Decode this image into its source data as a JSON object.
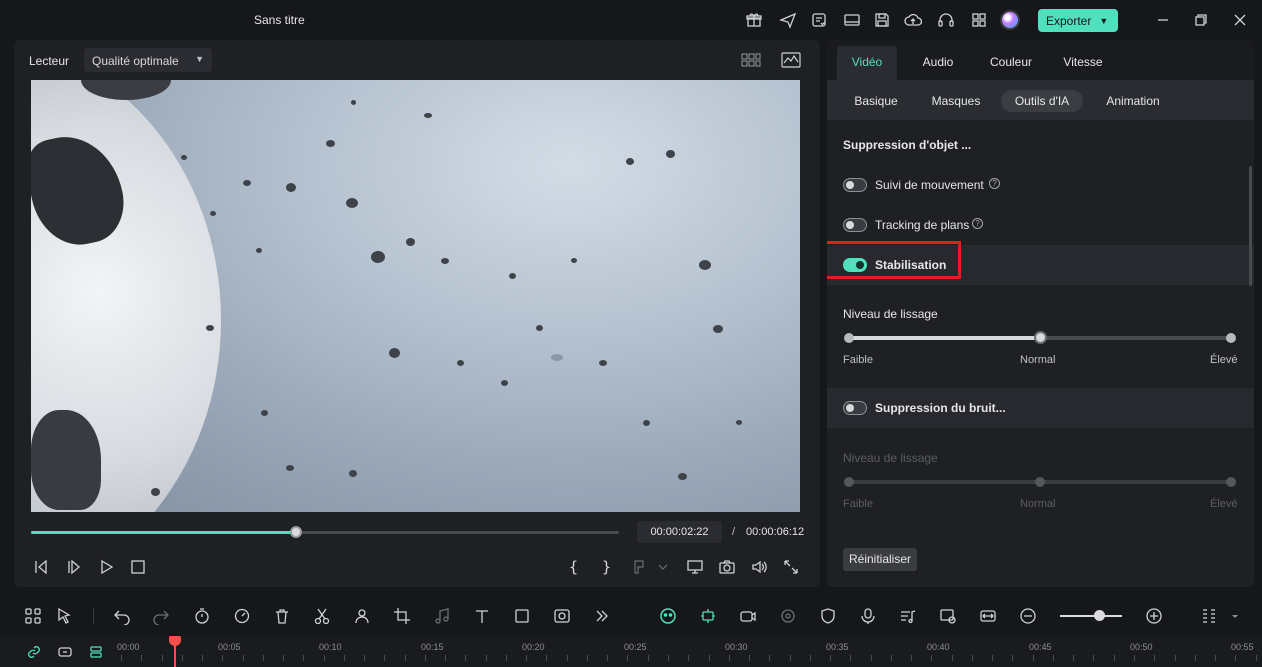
{
  "window": {
    "title": "Sans titre",
    "export_label": "Exporter",
    "accent": "#4fe0bd"
  },
  "player": {
    "label": "Lecteur",
    "quality": "Qualité optimale",
    "progress": 0.45,
    "current_time": "00:00:02:22",
    "separator": "/",
    "total_time": "00:00:06:12",
    "mark_in": "{",
    "mark_out": "}"
  },
  "props": {
    "main_tabs": [
      "Vidéo",
      "Audio",
      "Couleur",
      "Vitesse"
    ],
    "active_main_tab": "Vidéo",
    "sub_tabs": [
      "Basique",
      "Masques",
      "Outils d'IA",
      "Animation"
    ],
    "active_sub_tab": "Outils d'IA",
    "section_title": "Suppression d'objet ...",
    "toggles": [
      {
        "label": "Suivi de mouvement",
        "on": false,
        "help": true
      },
      {
        "label": "Tracking de plans",
        "on": false,
        "help": true
      },
      {
        "label": "Stabilisation",
        "on": true,
        "help": false
      }
    ],
    "smoothing": {
      "title": "Niveau de lissage",
      "min_label": "Faible",
      "mid_label": "Normal",
      "max_label": "Élevé",
      "value": "Normal"
    },
    "noise": {
      "label": "Suppression du bruit...",
      "on": false,
      "level_title": "Niveau de lissage",
      "min_label": "Faible",
      "mid_label": "Normal",
      "max_label": "Élevé"
    },
    "reset_label": "Réinitialiser"
  },
  "ruler": {
    "labels": [
      "00:00",
      "00:05",
      "00:10",
      "00:15",
      "00:20",
      "00:25",
      "00:30",
      "00:35",
      "00:40",
      "00:45",
      "00:50",
      "00:55"
    ]
  },
  "icons": {
    "titlebar": [
      "gift-icon",
      "send-icon",
      "checklist-icon",
      "layout-icon",
      "save-icon",
      "cloud-upload-icon",
      "headset-icon",
      "grid-icon"
    ],
    "toolbar": [
      "multi-select-icon",
      "pointer-icon",
      "undo-icon",
      "redo-icon",
      "timer-icon",
      "speed-icon",
      "delete-icon",
      "cut-icon",
      "crop-person-icon",
      "crop-icon",
      "audio-icon",
      "text-icon",
      "rectangle-icon",
      "color-match-icon",
      "more-icon",
      "ai-face-icon",
      "ai-stabilize-icon",
      "record-icon",
      "screen-icon",
      "shield-icon",
      "mic-icon",
      "audio-list-icon",
      "replace-icon",
      "fit-icon",
      "zoom-out-icon",
      "zoom-in-icon",
      "grip-icon",
      "dropdown-icon"
    ]
  }
}
